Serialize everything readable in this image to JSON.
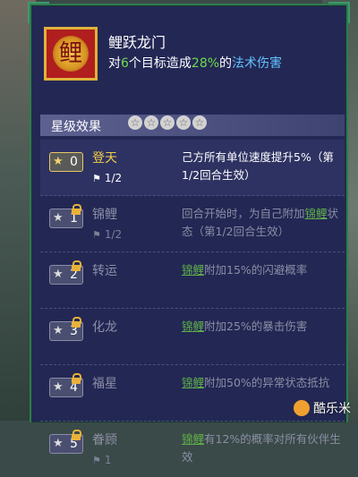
{
  "skill": {
    "name": "鲤跃龙门",
    "desc_prefix": "对",
    "target_count": "6",
    "desc_mid": "个目标造成",
    "damage_percent": "28%",
    "desc_of": "的",
    "damage_type": "法术伤害",
    "icon": "carp-dragon-icon"
  },
  "star_section": {
    "label": "星级效果",
    "stars": [
      "☆",
      "☆",
      "☆",
      "☆",
      "☆"
    ]
  },
  "levels": [
    {
      "num": "0",
      "name": "登天",
      "cooldown": "1/2",
      "desc": "己方所有单位速度提升5%（第1/2回合生效）",
      "locked": false,
      "active": true
    },
    {
      "num": "1",
      "name": "锦鲤",
      "cooldown": "1/2",
      "desc_a": "回合开始时，为自己附加",
      "keyword": "锦鲤",
      "desc_b": "状态（第1/2回合生效）",
      "locked": true,
      "active": false
    },
    {
      "num": "2",
      "name": "转运",
      "keyword": "锦鲤",
      "desc_b": "附加15%的闪避概率",
      "locked": true,
      "active": false
    },
    {
      "num": "3",
      "name": "化龙",
      "keyword": "锦鲤",
      "desc_b": "附加25%的暴击伤害",
      "locked": true,
      "active": false
    },
    {
      "num": "4",
      "name": "福星",
      "keyword": "锦鲤",
      "desc_b": "附加50%的异常状态抵抗",
      "locked": true,
      "active": false
    },
    {
      "num": "5",
      "name": "眷顾",
      "cooldown": "1",
      "keyword": "锦鲤",
      "desc_b": "有12%的概率对所有伙伴生效",
      "locked": true,
      "active": false
    }
  ],
  "watermark": {
    "text": "酷乐米"
  },
  "colors": {
    "panel": "#232754",
    "border": "#2f7a55",
    "highlight_green": "#6fdc4c",
    "highlight_blue": "#62c2ff",
    "gold": "#f2d044"
  }
}
